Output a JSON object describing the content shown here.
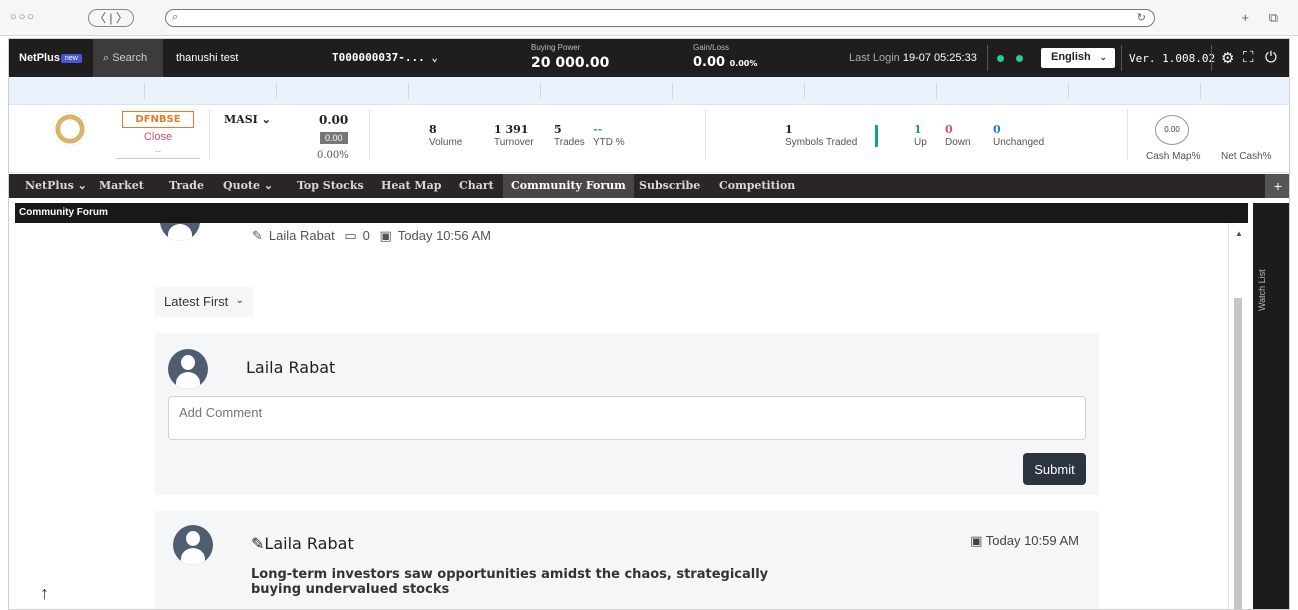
{
  "browser": {
    "dots": "○○○",
    "nav": "〈 | 〉",
    "url_icon": "search-icon",
    "reload_icon": "reload-icon",
    "right_icons": "+ ⧉"
  },
  "topbar": {
    "logo": "NetPlus",
    "new_badge": "new",
    "search_label": "Search",
    "user_name": "thanushi test",
    "account": "T000000037-...",
    "buying_power_label": "Buying Power",
    "buying_power": "20 000.00",
    "gain_loss_label": "Gain/Loss",
    "gain_loss": "0.00",
    "gain_loss_pct": "0.00%",
    "last_login_label": "Last Login",
    "last_login": "19-07 05:25:33",
    "language": "English",
    "version": "Ver. 1.008.02",
    "status_color": "#1fd18a"
  },
  "summary": {
    "exchange": "DFNBSE",
    "status": "Close",
    "status_sub": "--",
    "index_name": "MASI",
    "index_value": "0.00",
    "index_change": "0.00",
    "index_pct": "0.00%",
    "volume": "8",
    "volume_label": "Volume",
    "turnover": "1 391",
    "turnover_label": "Turnover",
    "trades": "5",
    "trades_label": "Trades",
    "ytd": "--",
    "ytd_label": "YTD %",
    "symbols_traded": "1",
    "symbols_traded_label": "Symbols Traded",
    "up": "1",
    "up_label": "Up",
    "down": "0",
    "down_label": "Down",
    "unchanged": "0",
    "unchanged_label": "Unchanged",
    "gauge_value": "0.00",
    "cash_map_label": "Cash Map%",
    "net_cash_label": "Net Cash%"
  },
  "menu": {
    "items": [
      "NetPlus",
      "Market",
      "Trade",
      "Quote",
      "Top Stocks",
      "Heat Map",
      "Chart",
      "Community Forum",
      "Subscribe",
      "Competition"
    ],
    "plus": "+"
  },
  "forum": {
    "title": "Community Forum",
    "top_post": {
      "author": "Laila Rabat",
      "comments": "0",
      "time": "Today 10:56 AM"
    },
    "sort": "Latest First",
    "composer": {
      "name": "Laila Rabat",
      "placeholder": "Add Comment",
      "submit": "Submit"
    },
    "post": {
      "author": "Laila Rabat",
      "time": "Today 10:59 AM",
      "text": "Long-term investors saw opportunities amidst the chaos, strategically buying undervalued stocks"
    },
    "watch_list": "Watch List"
  }
}
